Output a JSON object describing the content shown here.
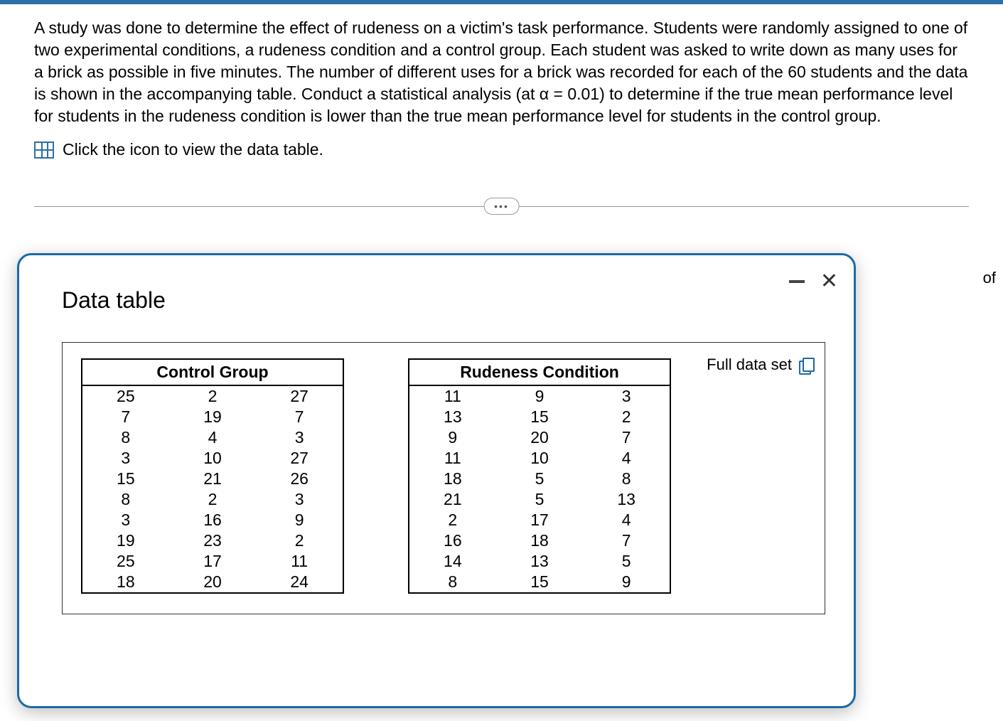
{
  "prompt_text": "A study was done to determine the effect of rudeness on a victim's task performance. Students were randomly assigned to one of two experimental conditions, a rudeness condition and a control group. Each student was asked to write down as many uses for a brick as possible in five minutes. The number of different uses for a brick was recorded for each of the 60 students and the data is shown in the accompanying table. Conduct a statistical analysis (at α = 0.01) to determine if the true mean performance level for students in the rudeness condition is lower than the true mean performance level for students in the control group.",
  "icon_line_text": "Click the icon to view the data table.",
  "divider_label": "•••",
  "side_text": "of",
  "modal": {
    "title": "Data table",
    "full_data_label": "Full data set"
  },
  "chart_data": {
    "type": "table",
    "tables": [
      {
        "title": "Control Group",
        "rows": [
          [
            25,
            2,
            27
          ],
          [
            7,
            19,
            7
          ],
          [
            8,
            4,
            3
          ],
          [
            3,
            10,
            27
          ],
          [
            15,
            21,
            26
          ],
          [
            8,
            2,
            3
          ],
          [
            3,
            16,
            9
          ],
          [
            19,
            23,
            2
          ],
          [
            25,
            17,
            11
          ],
          [
            18,
            20,
            24
          ]
        ]
      },
      {
        "title": "Rudeness Condition",
        "rows": [
          [
            11,
            9,
            3
          ],
          [
            13,
            15,
            2
          ],
          [
            9,
            20,
            7
          ],
          [
            11,
            10,
            4
          ],
          [
            18,
            5,
            8
          ],
          [
            21,
            5,
            13
          ],
          [
            2,
            17,
            4
          ],
          [
            16,
            18,
            7
          ],
          [
            14,
            13,
            5
          ],
          [
            8,
            15,
            9
          ]
        ]
      }
    ]
  }
}
